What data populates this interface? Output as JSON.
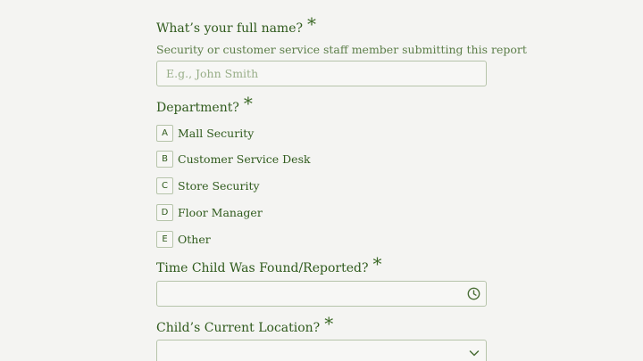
{
  "form": {
    "full_name": {
      "label": "What’s your full name?",
      "required_mark": "*",
      "help": "Security or customer service staff member submitting this report",
      "placeholder": "E.g., John Smith",
      "value": ""
    },
    "department": {
      "label": "Department?",
      "required_mark": "*",
      "options": [
        {
          "key": "A",
          "label": "Mall Security"
        },
        {
          "key": "B",
          "label": "Customer Service Desk"
        },
        {
          "key": "C",
          "label": "Store Security"
        },
        {
          "key": "D",
          "label": "Floor Manager"
        },
        {
          "key": "E",
          "label": "Other"
        }
      ]
    },
    "time_found": {
      "label": "Time Child Was Found/Reported?",
      "required_mark": "*",
      "value": "",
      "icon": "clock-icon"
    },
    "current_location": {
      "label": "Child’s Current Location?",
      "required_mark": "*",
      "value": "",
      "icon": "chevron-down-icon"
    }
  },
  "colors": {
    "text": "#2f5a1c",
    "help": "#5c7e49",
    "border": "#b6c4aa",
    "background": "#f4f4f2"
  }
}
